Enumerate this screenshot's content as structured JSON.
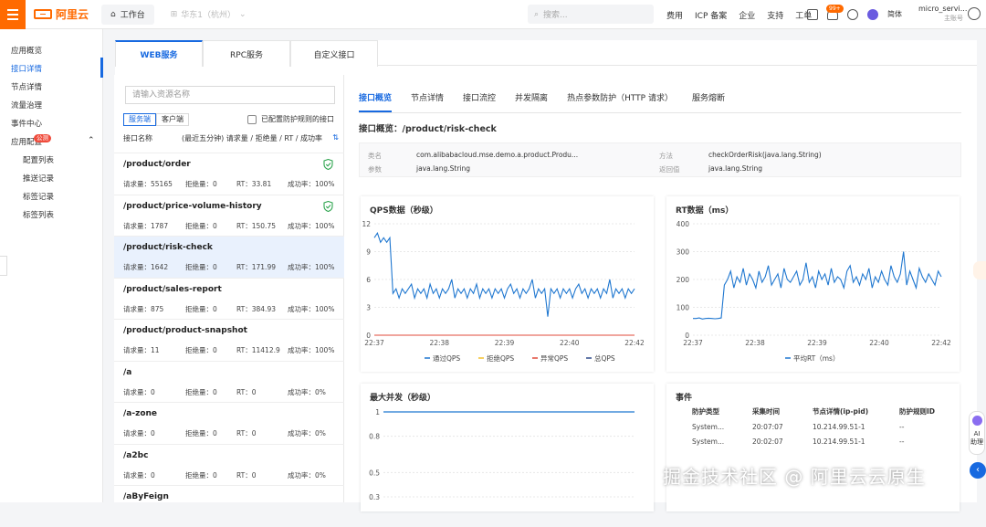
{
  "topbar": {
    "brand": "阿里云",
    "workbench": "工作台",
    "region": "华东1（杭州）",
    "search_placeholder": "搜索...",
    "links": [
      "费用",
      "ICP 备案",
      "企业",
      "支持",
      "工单"
    ],
    "notif_count": "99+",
    "lang": "简体",
    "user_name": "micro_servi...",
    "user_role": "主账号"
  },
  "sidebar": {
    "items": [
      {
        "label": "应用概览",
        "active": false
      },
      {
        "label": "接口详情",
        "active": true
      },
      {
        "label": "节点详情",
        "active": false
      },
      {
        "label": "流量治理",
        "active": false
      },
      {
        "label": "事件中心",
        "active": false
      },
      {
        "label": "应用配置",
        "active": false
      }
    ],
    "new_badge": "公测",
    "sub_items": [
      "配置列表",
      "推送记录",
      "标签记录",
      "标签列表"
    ]
  },
  "main_tabs": [
    {
      "label": "WEB服务",
      "active": true
    },
    {
      "label": "RPC服务",
      "active": false
    },
    {
      "label": "自定义接口",
      "active": false
    }
  ],
  "left": {
    "search_placeholder": "请输入资源名称",
    "toggle": [
      "服务端",
      "客户端"
    ],
    "checkbox_label": "已配置防护规则的接口",
    "header_name": "接口名称",
    "header_metrics": "(最近五分钟) 请求量 / 拒绝量 / RT / 成功率",
    "rows": [
      {
        "name": "/product/order",
        "req": "请求量：55165",
        "rej": "拒绝量：0",
        "rt": "RT：33.81",
        "succ": "成功率：100%",
        "shield": true,
        "sel": false
      },
      {
        "name": "/product/price-volume-history",
        "req": "请求量：1787",
        "rej": "拒绝量：0",
        "rt": "RT：150.75",
        "succ": "成功率：100%",
        "shield": true,
        "sel": false
      },
      {
        "name": "/product/risk-check",
        "req": "请求量：1642",
        "rej": "拒绝量：0",
        "rt": "RT：171.99",
        "succ": "成功率：100%",
        "shield": false,
        "sel": true
      },
      {
        "name": "/product/sales-report",
        "req": "请求量：875",
        "rej": "拒绝量：0",
        "rt": "RT：384.93",
        "succ": "成功率：100%",
        "shield": false,
        "sel": false
      },
      {
        "name": "/product/product-snapshot",
        "req": "请求量：11",
        "rej": "拒绝量：0",
        "rt": "RT：11412.9",
        "succ": "成功率：100%",
        "shield": false,
        "sel": false
      },
      {
        "name": "/a",
        "req": "请求量：0",
        "rej": "拒绝量：0",
        "rt": "RT：0",
        "succ": "成功率：0%",
        "shield": false,
        "sel": false
      },
      {
        "name": "/a-zone",
        "req": "请求量：0",
        "rej": "拒绝量：0",
        "rt": "RT：0",
        "succ": "成功率：0%",
        "shield": false,
        "sel": false
      },
      {
        "name": "/a2bc",
        "req": "请求量：0",
        "rej": "拒绝量：0",
        "rt": "RT：0",
        "succ": "成功率：0%",
        "shield": false,
        "sel": false
      },
      {
        "name": "/aByFeign",
        "req": "",
        "rej": "",
        "rt": "",
        "succ": "",
        "shield": false,
        "sel": false
      }
    ]
  },
  "right": {
    "subtabs": [
      {
        "label": "接口概览",
        "active": true
      },
      {
        "label": "节点详情",
        "active": false
      },
      {
        "label": "接口流控",
        "active": false
      },
      {
        "label": "并发隔离",
        "active": false
      },
      {
        "label": "热点参数防护（HTTP 请求）",
        "active": false
      },
      {
        "label": "服务熔断",
        "active": false
      }
    ],
    "overview_title": "接口概览：/product/risk-check",
    "info": {
      "class_key": "类名",
      "class_val": "com.alibabacloud.mse.demo.a.product.Produ...",
      "param_key": "参数",
      "param_val": "java.lang.String",
      "method_key": "方法",
      "method_val": "checkOrderRisk(java.lang.String)",
      "ret_key": "返回值",
      "ret_val": "java.lang.String"
    },
    "qps_title": "QPS数据（秒级）",
    "rt_title": "RT数据（ms）",
    "conc_title": "最大并发（秒级）",
    "events": {
      "title": "事件",
      "headers": [
        "防护类型",
        "采集时间",
        "节点详情(ip-pid)",
        "防护规则ID"
      ],
      "rows": [
        [
          "System...",
          "20:07:07",
          "10.214.99.51-1",
          "--"
        ],
        [
          "System...",
          "20:02:07",
          "10.214.99.51-1",
          "--"
        ]
      ]
    }
  },
  "chart_data": [
    {
      "type": "line",
      "title": "QPS数据（秒级）",
      "x": [
        "22:37",
        "22:38",
        "22:39",
        "22:40",
        "22:42"
      ],
      "ylim": [
        0,
        12
      ],
      "yticks": [
        0,
        3,
        6,
        9,
        12
      ],
      "series": [
        {
          "name": "通过QPS",
          "color": "#1f77d0",
          "values": [
            10.5,
            11,
            10,
            10.5,
            10,
            10.5,
            4.5,
            5,
            4,
            5,
            4.5,
            5,
            5.5,
            4,
            5,
            4.5,
            5,
            4,
            5.5,
            4.5,
            5,
            4,
            5,
            4.5,
            5,
            6,
            4,
            5,
            4.5,
            5,
            4,
            5,
            4.5,
            5.5,
            4,
            5,
            4.5,
            5,
            4,
            5,
            4.5,
            5,
            4,
            5,
            5.5,
            4.5,
            5,
            4,
            5,
            4.5,
            5,
            6,
            4,
            5,
            4.5,
            5,
            2,
            5,
            4.5,
            5,
            4,
            5,
            4.5,
            5,
            4,
            5,
            5.5,
            4.5,
            5,
            4,
            5,
            4.5,
            5,
            4,
            5,
            4.5,
            6,
            4,
            5,
            4.5,
            5,
            4,
            5,
            4.5,
            5
          ]
        },
        {
          "name": "拒绝QPS",
          "color": "#f2c12e",
          "values": []
        },
        {
          "name": "异常QPS",
          "color": "#e04b3b",
          "values": [
            0,
            0
          ]
        },
        {
          "name": "总QPS",
          "color": "#2f4b8a",
          "values": []
        }
      ]
    },
    {
      "type": "line",
      "title": "RT数据（ms）",
      "x": [
        "22:37",
        "22:38",
        "22:39",
        "22:40",
        "22:42"
      ],
      "ylim": [
        0,
        400
      ],
      "yticks": [
        0,
        100,
        200,
        300,
        400
      ],
      "series": [
        {
          "name": "平均RT（ms）",
          "color": "#1f77d0",
          "values": [
            60,
            60,
            62,
            58,
            60,
            61,
            60,
            59,
            60,
            62,
            180,
            200,
            230,
            170,
            210,
            190,
            240,
            180,
            220,
            200,
            170,
            230,
            190,
            210,
            250,
            180,
            200,
            220,
            170,
            240,
            200,
            190,
            210,
            230,
            180,
            200,
            260,
            190,
            210,
            170,
            230,
            200,
            220,
            180,
            240,
            190,
            210,
            200,
            170,
            230,
            250,
            190,
            210,
            180,
            220,
            200,
            240,
            170,
            210,
            190,
            230,
            200,
            180,
            250,
            210,
            190,
            220,
            300,
            180,
            230,
            200,
            170,
            240,
            210,
            190,
            220,
            200,
            180,
            230,
            210
          ]
        }
      ]
    },
    {
      "type": "line",
      "title": "最大并发（秒级）",
      "x": [],
      "ylim": [
        0.3,
        1
      ],
      "yticks": [
        0.3,
        0.5,
        0.8,
        1
      ],
      "series": [
        {
          "name": "",
          "color": "#1f77d0",
          "values": [
            1,
            1
          ]
        }
      ]
    }
  ],
  "ai": {
    "label": "AI 助理"
  },
  "watermark": "掘金技术社区 @ 阿里云云原生"
}
